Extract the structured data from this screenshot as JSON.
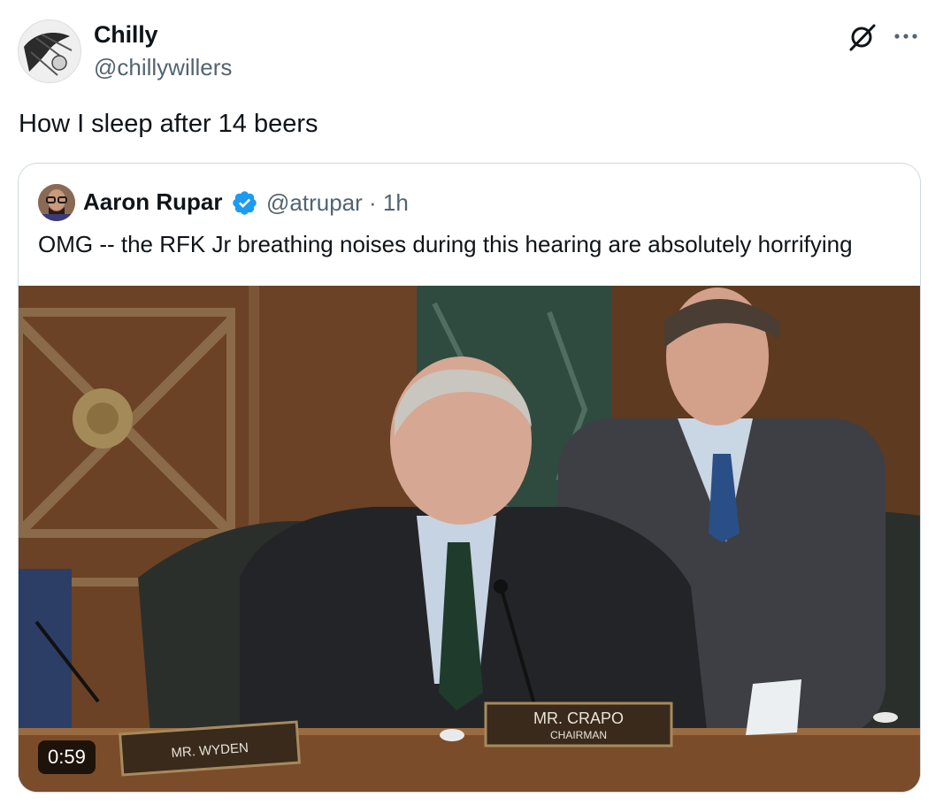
{
  "tweet": {
    "display_name": "Chilly",
    "handle": "@chillywillers",
    "text": "How I sleep after 14 beers"
  },
  "header_icons": [
    "grok-icon",
    "more-icon"
  ],
  "quoted_tweet": {
    "display_name": "Aaron Rupar",
    "verified": true,
    "handle_time": "@atrupar · 1h",
    "text": "OMG -- the RFK Jr breathing noises during this hearing are absolutely horrifying",
    "media": {
      "type": "video",
      "duration": "0:59",
      "nameplate_center": {
        "name": "MR. CRAPO",
        "title": "CHAIRMAN"
      },
      "nameplate_left": {
        "name": "MR. WYDEN"
      }
    }
  },
  "colors": {
    "text_primary": "#0f1419",
    "text_secondary": "#536471",
    "border": "#cfd9de",
    "verified_blue": "#1d9bf0"
  }
}
